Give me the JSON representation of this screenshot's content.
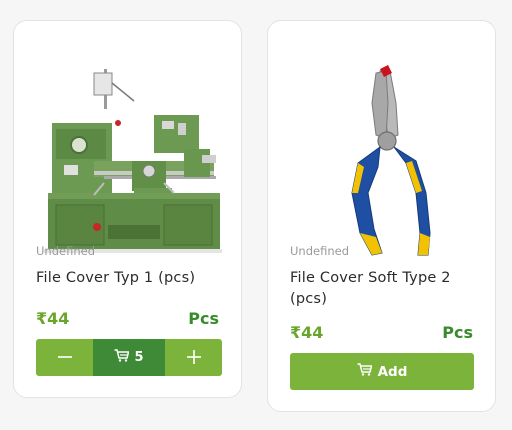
{
  "currency_symbol": "₹",
  "products": [
    {
      "category": "Undefined",
      "title": "File Cover Typ 1 (pcs)",
      "price": "₹44",
      "unit": "Pcs",
      "quantity": "5",
      "image_icon": "lathe-machine-icon"
    },
    {
      "category": "Undefined",
      "title": "File Cover Soft Type 2 (pcs)",
      "price": "₹44",
      "unit": "Pcs",
      "add_label": "Add",
      "image_icon": "pliers-icon"
    }
  ],
  "colors": {
    "accent_green": "#7cb33a",
    "dark_green": "#3f8a36",
    "price_green": "#6aa52b"
  }
}
